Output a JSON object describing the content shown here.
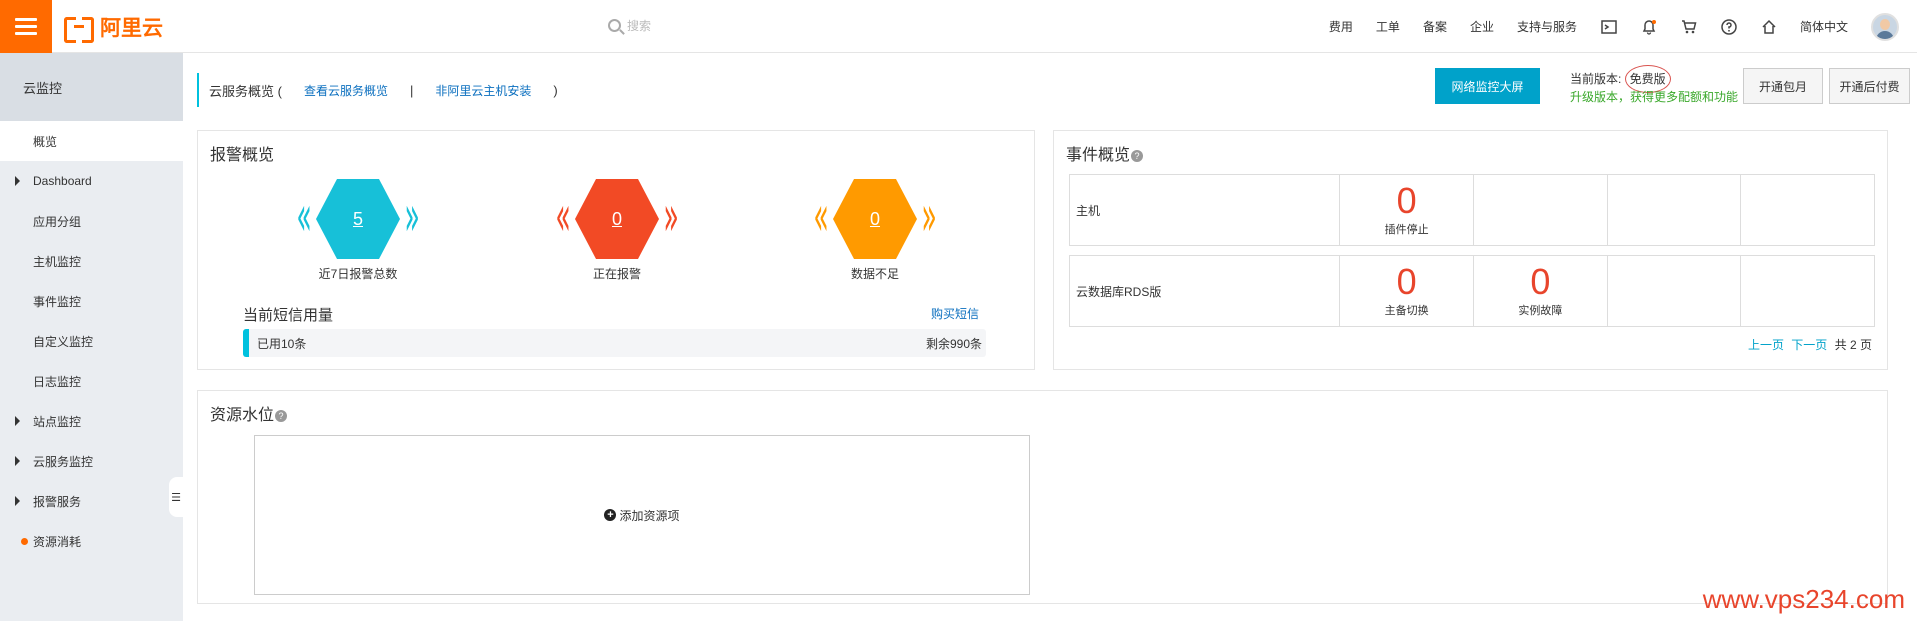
{
  "topbar": {
    "logo_text": "阿里云",
    "search_placeholder": "搜索",
    "nav": [
      "费用",
      "工单",
      "备案",
      "企业",
      "支持与服务"
    ],
    "language": "简体中文"
  },
  "sidebar": {
    "title": "云监控",
    "items": [
      {
        "label": "概览",
        "active": true,
        "expandable": false
      },
      {
        "label": "Dashboard",
        "expandable": true
      },
      {
        "label": "应用分组",
        "expandable": false
      },
      {
        "label": "主机监控",
        "expandable": false
      },
      {
        "label": "事件监控",
        "expandable": false
      },
      {
        "label": "自定义监控",
        "expandable": false
      },
      {
        "label": "日志监控",
        "expandable": false
      },
      {
        "label": "站点监控",
        "expandable": true
      },
      {
        "label": "云服务监控",
        "expandable": true
      },
      {
        "label": "报警服务",
        "expandable": true
      },
      {
        "label": "资源消耗",
        "expandable": false,
        "dot": true
      }
    ]
  },
  "header": {
    "title": "云服务概览 (",
    "link1": "查看云服务概览",
    "sep": "|",
    "link2": "非阿里云主机安装",
    "close_paren": ")",
    "primary_button": "网络监控大屏",
    "version_label": "当前版本: ",
    "version_value": "免费版",
    "upgrade_text": "升级版本，获得更多配额和功能",
    "btn_monthly": "开通包月",
    "btn_postpaid": "开通后付费"
  },
  "alarm": {
    "title": "报警概览",
    "stats": [
      {
        "value": "5",
        "label": "近7日报警总数",
        "color": "#17c0d8",
        "chev": "#17c0d8"
      },
      {
        "value": "0",
        "label": "正在报警",
        "color": "#f24a25",
        "chev": "#f24a25"
      },
      {
        "value": "0",
        "label": "数据不足",
        "color": "#ff9a00",
        "chev": "#ff9a00"
      }
    ],
    "sms_title": "当前短信用量",
    "sms_buy": "购买短信",
    "sms_used": "已用10条",
    "sms_remaining": "剩余990条"
  },
  "events": {
    "title": "事件概览",
    "rows": [
      {
        "name": "主机",
        "cells": [
          {
            "num": "0",
            "label": "插件停止"
          },
          null,
          null,
          null
        ]
      },
      {
        "name": "云数据库RDS版",
        "cells": [
          {
            "num": "0",
            "label": "主备切换"
          },
          {
            "num": "0",
            "label": "实例故障"
          },
          null,
          null
        ]
      }
    ],
    "prev": "上一页",
    "next": "下一页",
    "total": "共 2 页"
  },
  "resources": {
    "title": "资源水位",
    "add_label": "添加资源项"
  },
  "watermark": "www.vps234.com"
}
